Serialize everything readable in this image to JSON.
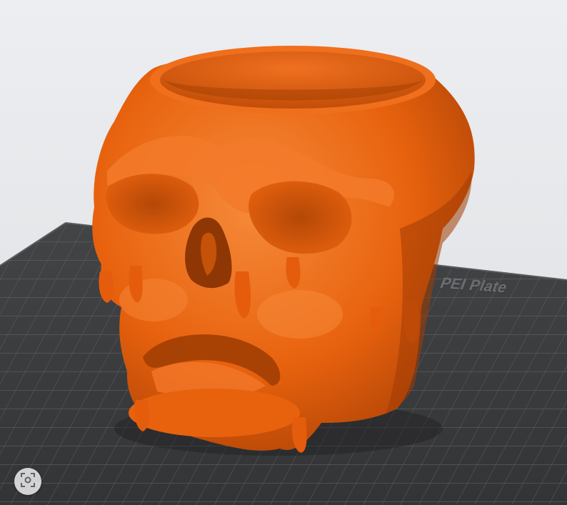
{
  "viewport": {
    "plate_label": "PEI Plate"
  },
  "icons": {
    "lens": "visual-search-icon"
  },
  "colors": {
    "model": "#e8620e",
    "plate": "#3b3c3e",
    "grid": "#6a6c6f",
    "background": "#e9eaec"
  }
}
